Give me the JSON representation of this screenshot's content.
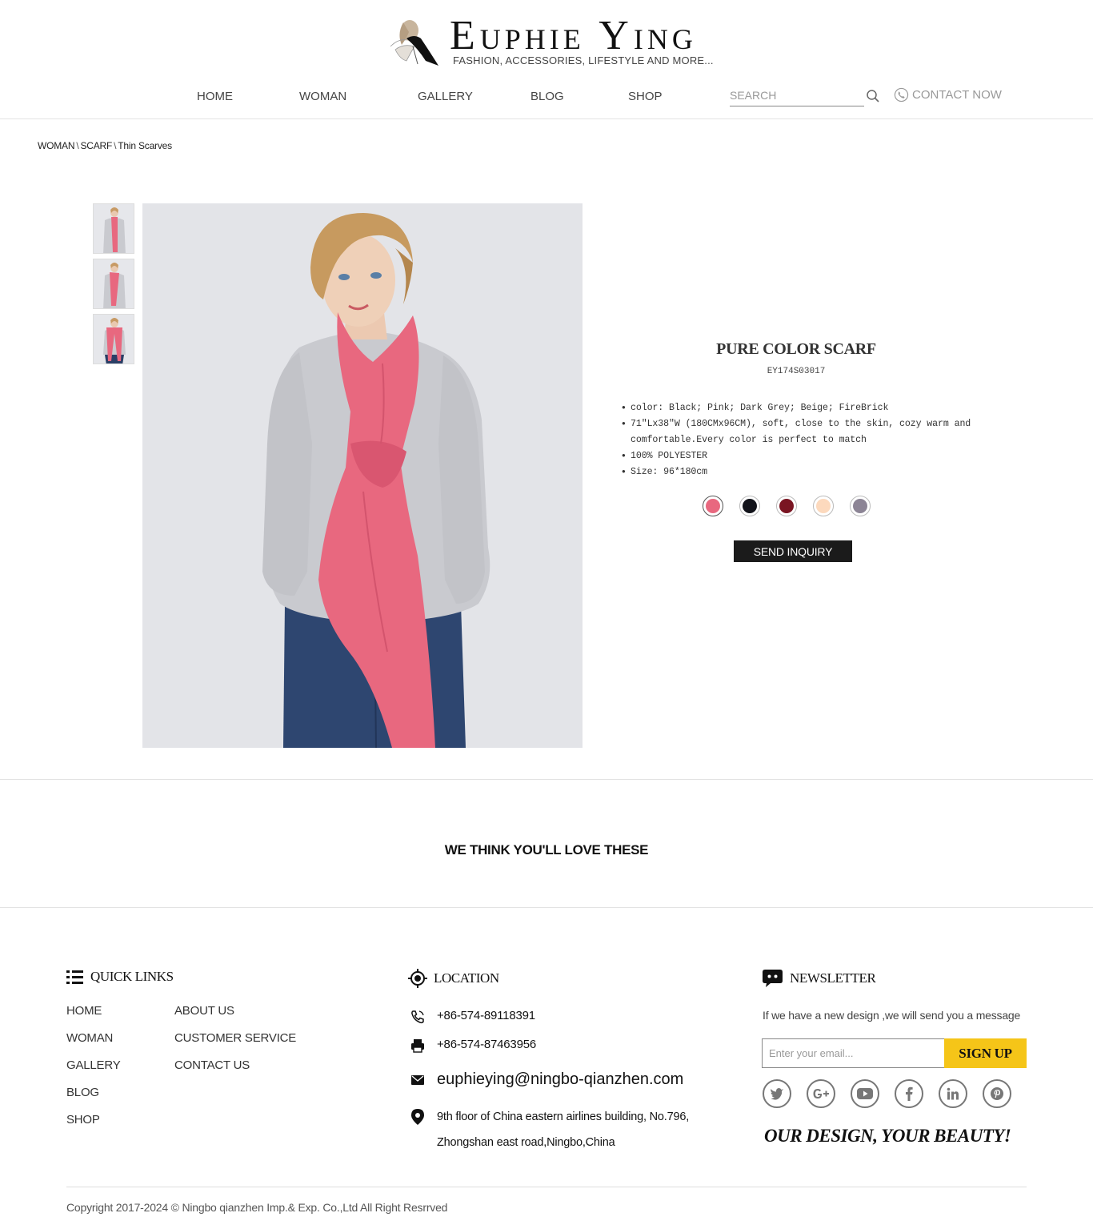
{
  "brand": {
    "name_first": "E",
    "name_first_rest": "UPHIE",
    "name_last": "Y",
    "name_last_rest": "ING",
    "tagline": "FASHION, ACCESSORIES, LIFESTYLE AND MORE..."
  },
  "nav": {
    "items": [
      {
        "label": "HOME"
      },
      {
        "label": "WOMAN"
      },
      {
        "label": "GALLERY"
      },
      {
        "label": "BLOG"
      },
      {
        "label": "SHOP"
      }
    ],
    "search_placeholder": "SEARCH",
    "contact_label": "CONTACT NOW"
  },
  "breadcrumb": {
    "items": [
      "WOMAN",
      "SCARF",
      "Thin Scarves"
    ],
    "separator": "\\"
  },
  "product": {
    "title": "PURE COLOR SCARF",
    "code": "EY174S03017",
    "features": [
      "color: Black; Pink; Dark Grey; Beige; FireBrick",
      "71\"Lx38\"W (180CMx96CM), soft, close to the skin, cozy warm and comfortable.Every color is perfect to match",
      "100% POLYESTER",
      "Size: 96*180cm"
    ],
    "swatches": [
      {
        "name": "pink",
        "color": "#e8687f",
        "selected": true
      },
      {
        "name": "black",
        "color": "#12131a",
        "selected": false
      },
      {
        "name": "firebrick",
        "color": "#7a1522",
        "selected": false
      },
      {
        "name": "beige",
        "color": "#fcd9bd",
        "selected": false
      },
      {
        "name": "dark-grey",
        "color": "#8c8495",
        "selected": false
      }
    ],
    "inquiry_label": "SEND INQUIRY",
    "scarf_color": "#e8687f",
    "thumbnails_count": 3
  },
  "related": {
    "title": "WE THINK YOU'LL LOVE THESE"
  },
  "footer": {
    "quick_links": {
      "heading": "QUICK LINKS",
      "col1": [
        "HOME",
        "WOMAN",
        "GALLERY",
        "BLOG",
        "SHOP"
      ],
      "col2": [
        "ABOUT US",
        "CUSTOMER SERVICE",
        "CONTACT US"
      ]
    },
    "location": {
      "heading": "LOCATION",
      "phone": "+86-574-89118391",
      "fax": "+86-574-87463956",
      "email": "euphieying@ningbo-qianzhen.com",
      "address": "9th floor of China eastern airlines building, No.796, Zhongshan east road,Ningbo,China"
    },
    "newsletter": {
      "heading": "NEWSLETTER",
      "text": "If we have a new design ,we will send you a message",
      "email_placeholder": "Enter your email...",
      "signup_label": "SIGN UP",
      "accent_color": "#f5c518",
      "socials": [
        "twitter-icon",
        "google-plus-icon",
        "youtube-icon",
        "facebook-icon",
        "linkedin-icon",
        "pinterest-icon"
      ],
      "slogan": "OUR DESIGN, YOUR BEAUTY!"
    },
    "copyright": "Copyright 2017-2024 © Ningbo qianzhen Imp.& Exp. Co.,Ltd All Right Resrrved"
  }
}
